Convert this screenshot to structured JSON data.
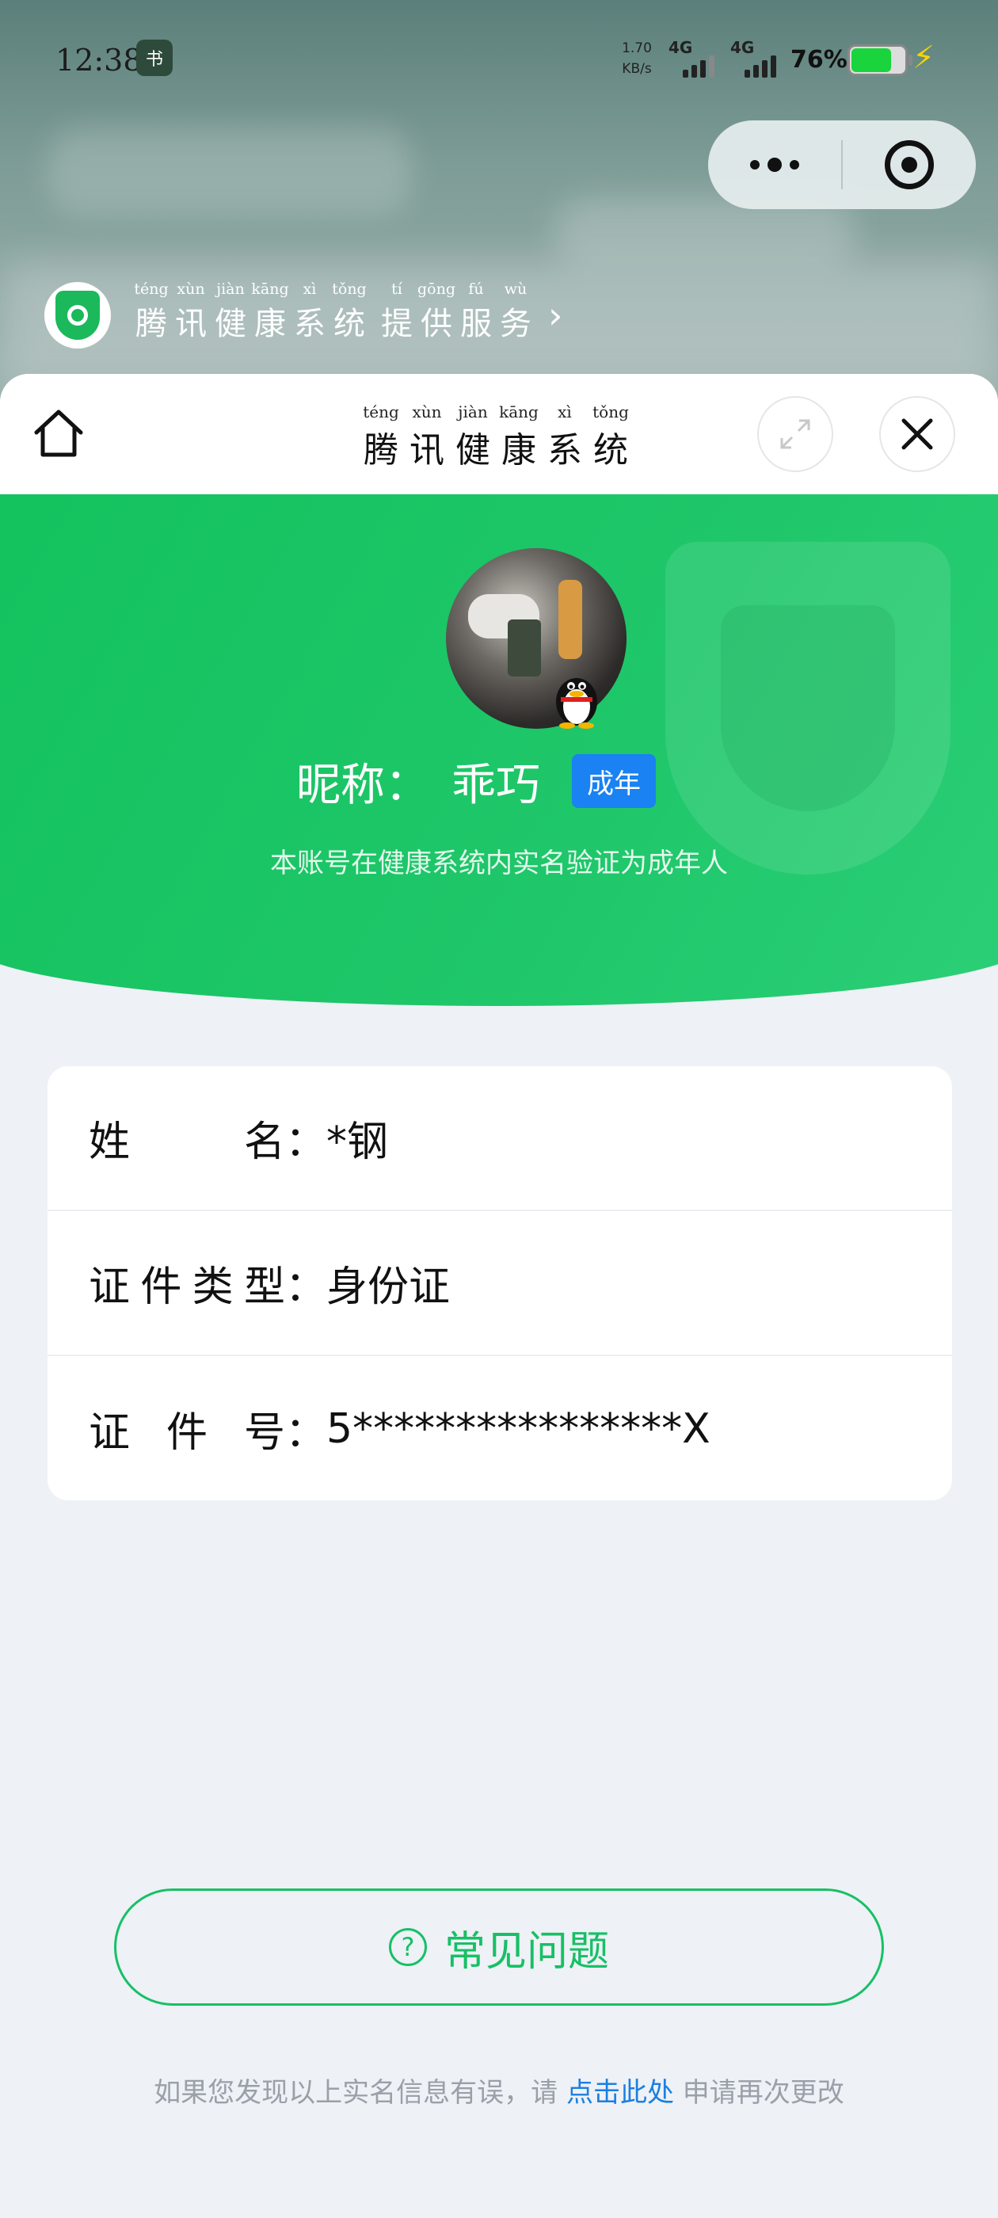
{
  "status_bar": {
    "time": "12:38",
    "app_badge": "书",
    "net_speed_value": "1.70",
    "net_speed_unit": "KB/s",
    "signal1": "4G",
    "signal2": "4G",
    "battery_pct": "76%",
    "battery_level": 0.76
  },
  "provider": {
    "pinyin": [
      "téng",
      "xùn",
      "jiàn",
      "kāng",
      "xì",
      "tǒng",
      "tí",
      "gōng",
      "fú",
      "wù"
    ],
    "hanzi": [
      "腾",
      "讯",
      "健",
      "康",
      "系",
      "统",
      "提",
      "供",
      "服",
      "务"
    ]
  },
  "sheet": {
    "title_pinyin": [
      "téng",
      "xùn",
      "jiàn",
      "kāng",
      "xì",
      "tǒng"
    ],
    "title_hanzi": [
      "腾",
      "讯",
      "健",
      "康",
      "系",
      "统"
    ]
  },
  "profile": {
    "nickname_label": "昵称：",
    "nickname": "乖巧",
    "tag": "成年",
    "verify_text": "本账号在健康系统内实名验证为成年人"
  },
  "info": {
    "rows": [
      {
        "label_chars": [
          "姓",
          "名："
        ],
        "value": "*钢"
      },
      {
        "label_chars": [
          "证",
          "件",
          "类",
          "型："
        ],
        "value": "身份证"
      },
      {
        "label_chars": [
          "证",
          "件",
          "号："
        ],
        "value": "5****************X"
      }
    ]
  },
  "faq": {
    "label": "常见问题",
    "icon": "?"
  },
  "footer": {
    "prefix": "如果您发现以上实名信息有误，请 ",
    "link": "点击此处",
    "suffix": " 申请再次更改"
  },
  "colors": {
    "brand_green": "#17c066",
    "tag_blue": "#1a82f2",
    "link_blue": "#1b7fe0"
  }
}
